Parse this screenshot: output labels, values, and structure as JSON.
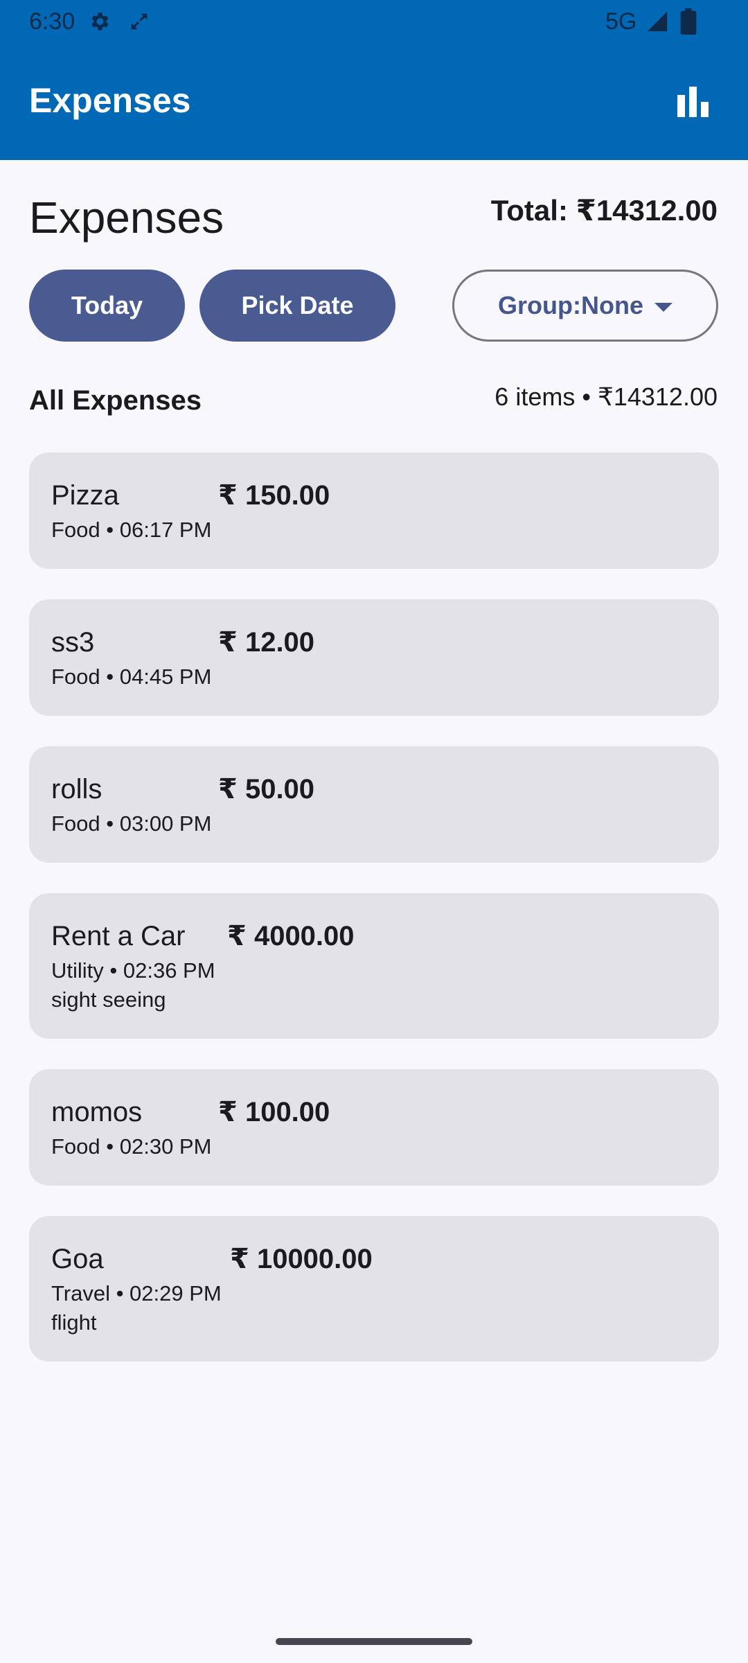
{
  "status_bar": {
    "time": "6:30",
    "network": "5G",
    "icons": [
      "gear-icon",
      "sync-icon",
      "signal-icon",
      "battery-icon"
    ]
  },
  "app_bar": {
    "title": "Expenses",
    "action_icon": "bar-chart-icon"
  },
  "header": {
    "title": "Expenses",
    "total": "Total: ₹14312.00"
  },
  "filters": {
    "today_label": "Today",
    "pick_date_label": "Pick Date",
    "group_label": "Group:None"
  },
  "list": {
    "title": "All Expenses",
    "summary": "6 items • ₹14312.00",
    "items": [
      {
        "name": "Pizza",
        "amount": "₹ 150.00",
        "meta": "Food • 06:17 PM",
        "note": ""
      },
      {
        "name": "ss3",
        "amount": "₹ 12.00",
        "meta": "Food • 04:45 PM",
        "note": ""
      },
      {
        "name": "rolls",
        "amount": "₹ 50.00",
        "meta": "Food • 03:00 PM",
        "note": ""
      },
      {
        "name": "Rent a Car",
        "amount": "₹ 4000.00",
        "meta": "Utility • 02:36 PM",
        "note": "sight seeing"
      },
      {
        "name": "momos",
        "amount": "₹ 100.00",
        "meta": "Food • 02:30 PM",
        "note": ""
      },
      {
        "name": "Goa",
        "amount": "₹ 10000.00",
        "meta": "Travel • 02:29 PM",
        "note": "flight"
      }
    ]
  },
  "colors": {
    "primary": "#0068b5",
    "pill": "#4a5b91",
    "card": "#e3e2e8",
    "background": "#f7f7fc"
  }
}
